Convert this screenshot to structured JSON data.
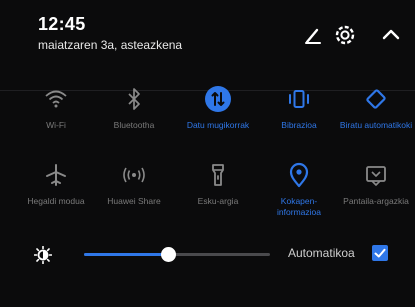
{
  "header": {
    "time": "12:45",
    "date": "maiatzaren 3a, asteazkena"
  },
  "tiles": [
    {
      "label": "Wi-Fi",
      "icon": "wifi-icon",
      "active": false
    },
    {
      "label": "Bluetootha",
      "icon": "bluetooth-icon",
      "active": false
    },
    {
      "label": "Datu mugikorrak",
      "icon": "mobile-data-icon",
      "active": true
    },
    {
      "label": "Bibrazioa",
      "icon": "vibration-icon",
      "active": true
    },
    {
      "label": "Biratu automatikoki",
      "icon": "auto-rotate-icon",
      "active": true
    },
    {
      "label": "Hegaldi modua",
      "icon": "airplane-icon",
      "active": false
    },
    {
      "label": "Huawei Share",
      "icon": "share-icon",
      "active": false
    },
    {
      "label": "Esku-argia",
      "icon": "flashlight-icon",
      "active": false
    },
    {
      "label": "Kokapen-informazioa",
      "icon": "location-icon",
      "active": true
    },
    {
      "label": "Pantaila-argazkia",
      "icon": "screenshot-icon",
      "active": false
    }
  ],
  "brightness": {
    "level": 0.45,
    "auto_label": "Automatikoa",
    "auto_checked": true
  },
  "colors": {
    "accent": "#2f77e8",
    "inactive": "#7a7a7a",
    "background": "#0b0b0c"
  }
}
